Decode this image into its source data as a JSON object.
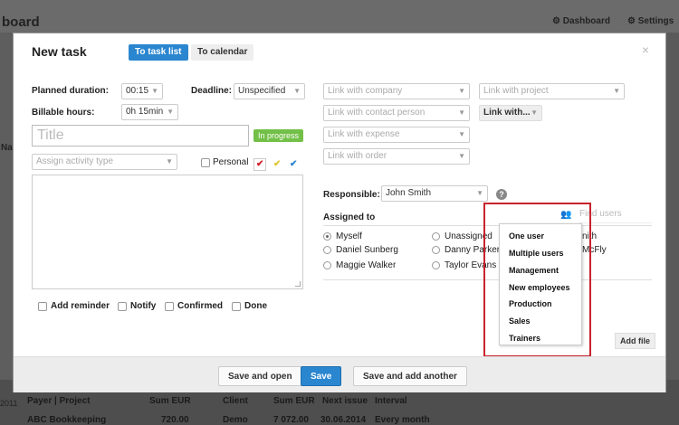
{
  "background": {
    "title": "board",
    "nav": {
      "dashboard": "Dashboard",
      "settings": "Settings"
    },
    "left_label": "Na",
    "table": {
      "headers": [
        "Payer | Project",
        "Sum EUR",
        "Client",
        "Sum EUR",
        "Next issue",
        "Interval"
      ],
      "row": [
        "ABC Bookkeeping",
        "720.00",
        "Demo",
        "7 072.00",
        "30.06.2014",
        "Every month"
      ],
      "year": "2011"
    }
  },
  "dialog": {
    "title": "New task",
    "tabs": {
      "list": "To task list",
      "calendar": "To calendar"
    },
    "close": "×",
    "planned_duration": {
      "label": "Planned duration:",
      "value": "00:15"
    },
    "deadline": {
      "label": "Deadline:",
      "value": "Unspecified"
    },
    "billable_hours": {
      "label": "Billable hours:",
      "value": "0h 15min"
    },
    "title_placeholder": "Title",
    "status_badge": "In progress",
    "activity_type_placeholder": "Assign activity type",
    "personal_label": "Personal",
    "links": {
      "company": "Link with company",
      "project": "Link with project",
      "contact": "Link with contact person",
      "more": "Link with...",
      "expense": "Link with expense",
      "order": "Link with order"
    },
    "responsible": {
      "label": "Responsible:",
      "value": "John Smith"
    },
    "assigned_to": {
      "label": "Assigned to",
      "find_placeholder": "Find users",
      "people": [
        "Myself",
        "Daniel Sunberg",
        "Maggie Walker",
        "Unassigned",
        "Danny Parker",
        "Taylor Evans"
      ],
      "partial": [
        "nith",
        "McFly"
      ],
      "dropdown": [
        "One user",
        "Multiple users",
        "Management",
        "New employees",
        "Production",
        "Sales",
        "Trainers"
      ]
    },
    "checkboxes": {
      "reminder": "Add reminder",
      "notify": "Notify",
      "confirmed": "Confirmed",
      "done": "Done"
    },
    "add_file": "Add file",
    "footer": {
      "save_open": "Save and open",
      "save": "Save",
      "save_another": "Save and add another"
    }
  }
}
